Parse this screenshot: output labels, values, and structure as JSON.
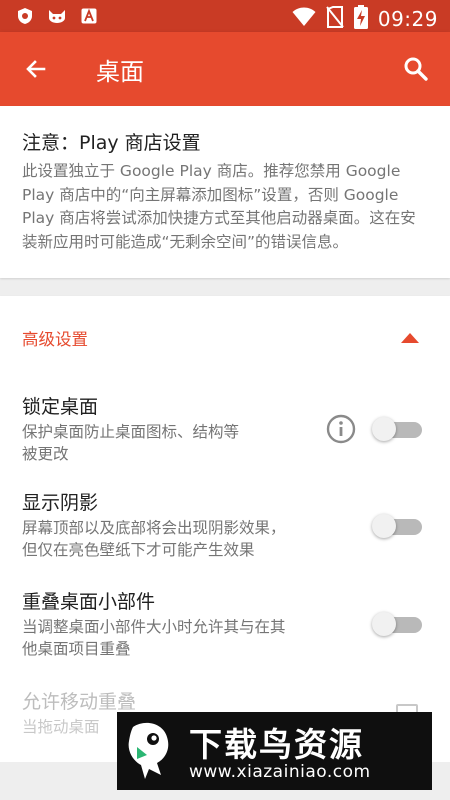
{
  "status_bar": {
    "left_icons": [
      "shield-icon",
      "cat-icon",
      "font-a-icon"
    ],
    "right_icons": [
      "wifi-icon",
      "no-sim-icon",
      "battery-charging-icon"
    ],
    "time": "09:29"
  },
  "app_bar": {
    "title": "桌面",
    "color": "#e64a2e"
  },
  "notice": {
    "title": "注意：Play 商店设置",
    "body": "此设置独立于 Google Play 商店。推荐您禁用 Google Play 商店中的“向主屏幕添加图标”设置，否则 Google Play 商店将尝试添加快捷方式至其他启动器桌面。这在安装新应用时可能造成“无剩余空间”的错误信息。"
  },
  "advanced": {
    "header": "高级设置",
    "expanded": true,
    "items": [
      {
        "title": "锁定桌面",
        "summary_line1": "保护桌面防止桌面图标、结构等",
        "summary_line2": "被更改",
        "enabled": false
      },
      {
        "title": "显示阴影",
        "summary_line1": "屏幕顶部以及底部将会出现阴影效果，",
        "summary_line2": "但仅在亮色壁纸下才可能产生效果",
        "enabled": false
      },
      {
        "title": "重叠桌面小部件",
        "summary_line1": "当调整桌面小部件大小时允许其与在其",
        "summary_line2": "他桌面项目重叠",
        "enabled": false
      },
      {
        "title": "允许移动重叠",
        "summary": "当拖动桌面",
        "checked": false,
        "disabled": true
      }
    ]
  },
  "watermark": {
    "title": "下载鸟资源",
    "url": "www.xiazainiao.com"
  }
}
